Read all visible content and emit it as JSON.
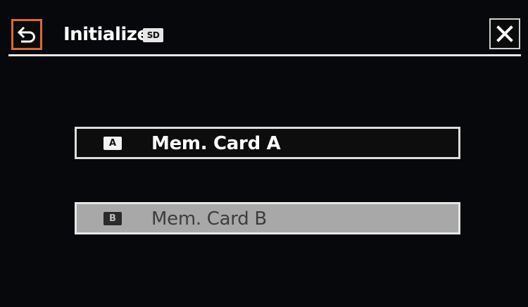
{
  "header": {
    "title": "Initialize",
    "media_badge": "SD",
    "back_icon": "back-arrow-icon",
    "close_icon": "close-x-icon"
  },
  "options": [
    {
      "icon_letter": "A",
      "label": "Mem. Card A",
      "state": "selectable"
    },
    {
      "icon_letter": "B",
      "label": "Mem. Card B",
      "state": "selected"
    }
  ],
  "colors": {
    "background": "#07080b",
    "back_button_border": "#d76a38",
    "divider": "#e8e8e8",
    "selected_option_fill": "#a8a8a8",
    "unselected_option_fill": "#0d0d0d"
  }
}
